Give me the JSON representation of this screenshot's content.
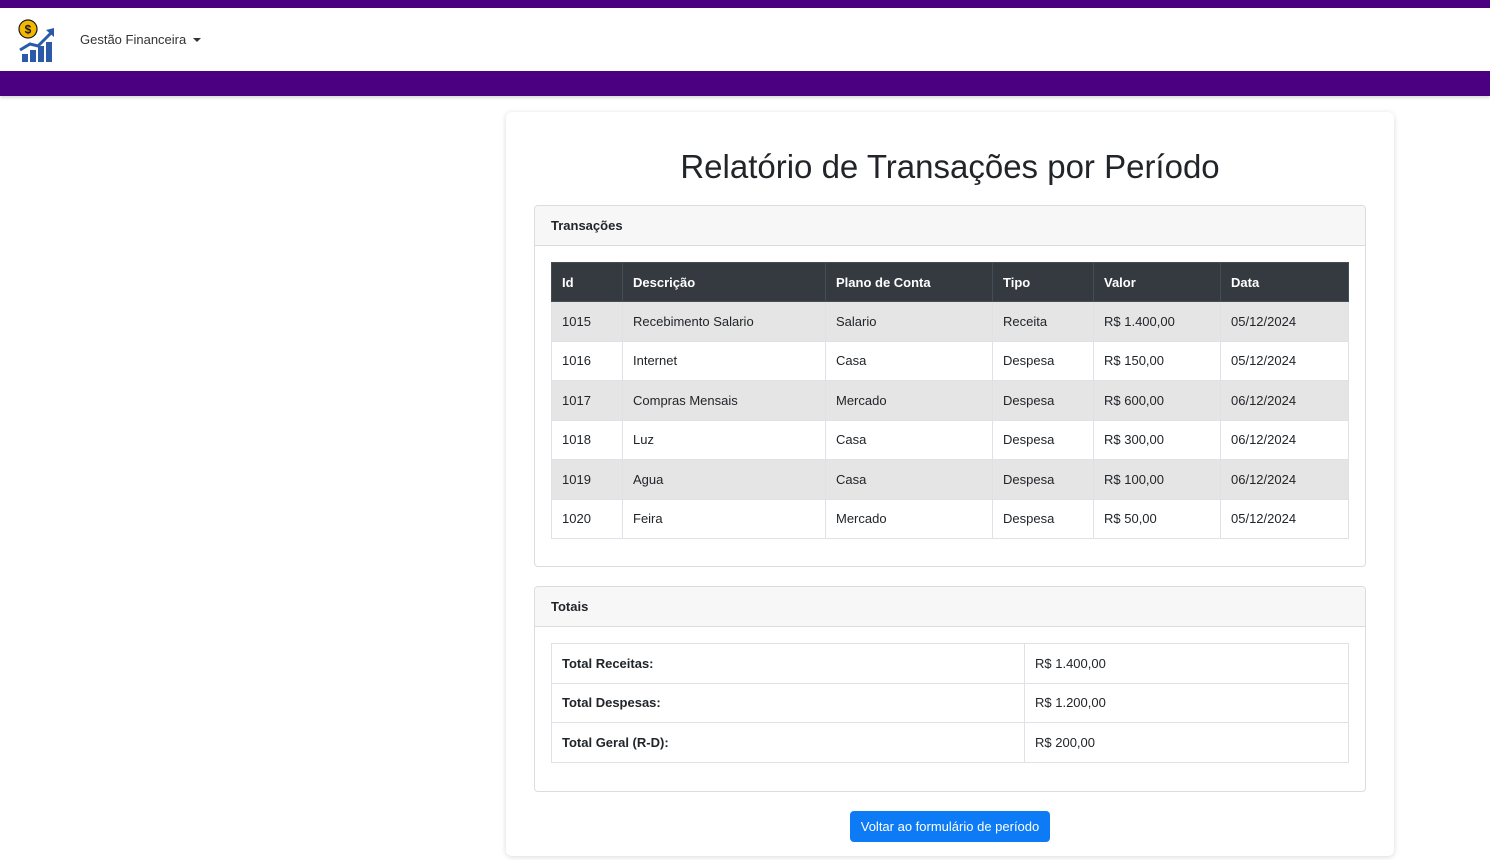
{
  "navbar": {
    "logo_icon": "finance-growth-logo-icon",
    "dropdown_label": "Gestão Financeira",
    "brand_color": "#4b0082"
  },
  "page": {
    "title": "Relatório de Transações por Período"
  },
  "transactions": {
    "header": "Transações",
    "columns": [
      "Id",
      "Descrição",
      "Plano de Conta",
      "Tipo",
      "Valor",
      "Data"
    ],
    "rows": [
      [
        "1015",
        "Recebimento Salario",
        "Salario",
        "Receita",
        "R$ 1.400,00",
        "05/12/2024"
      ],
      [
        "1016",
        "Internet",
        "Casa",
        "Despesa",
        "R$ 150,00",
        "05/12/2024"
      ],
      [
        "1017",
        "Compras Mensais",
        "Mercado",
        "Despesa",
        "R$ 600,00",
        "06/12/2024"
      ],
      [
        "1018",
        "Luz",
        "Casa",
        "Despesa",
        "R$ 300,00",
        "06/12/2024"
      ],
      [
        "1019",
        "Agua",
        "Casa",
        "Despesa",
        "R$ 100,00",
        "06/12/2024"
      ],
      [
        "1020",
        "Feira",
        "Mercado",
        "Despesa",
        "R$ 50,00",
        "05/12/2024"
      ]
    ]
  },
  "totals": {
    "header": "Totais",
    "rows": [
      {
        "label": "Total Receitas:",
        "value": "R$ 1.400,00"
      },
      {
        "label": "Total Despesas:",
        "value": "R$ 1.200,00"
      },
      {
        "label": "Total Geral (R-D):",
        "value": "R$ 200,00"
      }
    ]
  },
  "actions": {
    "back_label": "Voltar ao formulário de período",
    "button_color": "#0d7bf5"
  }
}
